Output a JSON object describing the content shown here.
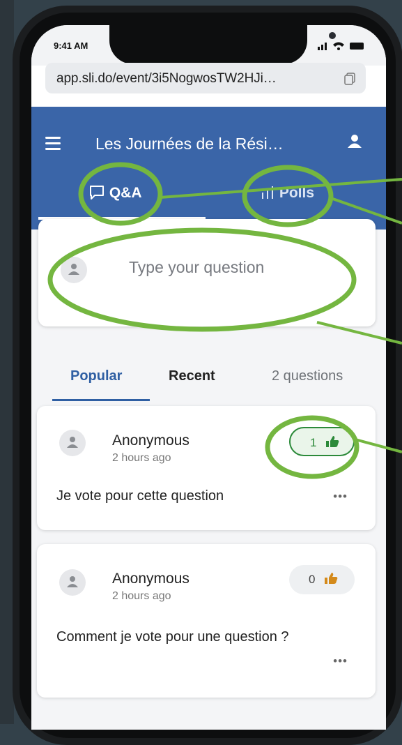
{
  "status_bar": {
    "time": "9:41 AM"
  },
  "browser": {
    "url": "app.sli.do/event/3i5NogwosTW2HJi…"
  },
  "header": {
    "title": "Les Journées de la Rési…"
  },
  "tabs": [
    {
      "label": "Q&A",
      "active": true
    },
    {
      "label": "Polls",
      "active": false
    }
  ],
  "question_input": {
    "placeholder": "Type your question"
  },
  "filters": {
    "popular": "Popular",
    "recent": "Recent",
    "count": "2 questions"
  },
  "questions": [
    {
      "author": "Anonymous",
      "time": "2 hours ago",
      "text": "Je vote pour cette question",
      "votes": "1",
      "voted": true
    },
    {
      "author": "Anonymous",
      "time": "2 hours ago",
      "text": "Comment je vote pour une question ?",
      "votes": "0",
      "voted": false
    }
  ],
  "colors": {
    "header": "#3a65a8",
    "accent": "#2f5fa3",
    "highlight": "#74b640",
    "vote_active": "#2c8a3a"
  },
  "icons": [
    "menu-icon",
    "user-icon",
    "chat-bubble-icon",
    "bar-chart-icon",
    "avatar-icon",
    "thumbs-up-icon",
    "copy-icon",
    "more-options-icon"
  ]
}
